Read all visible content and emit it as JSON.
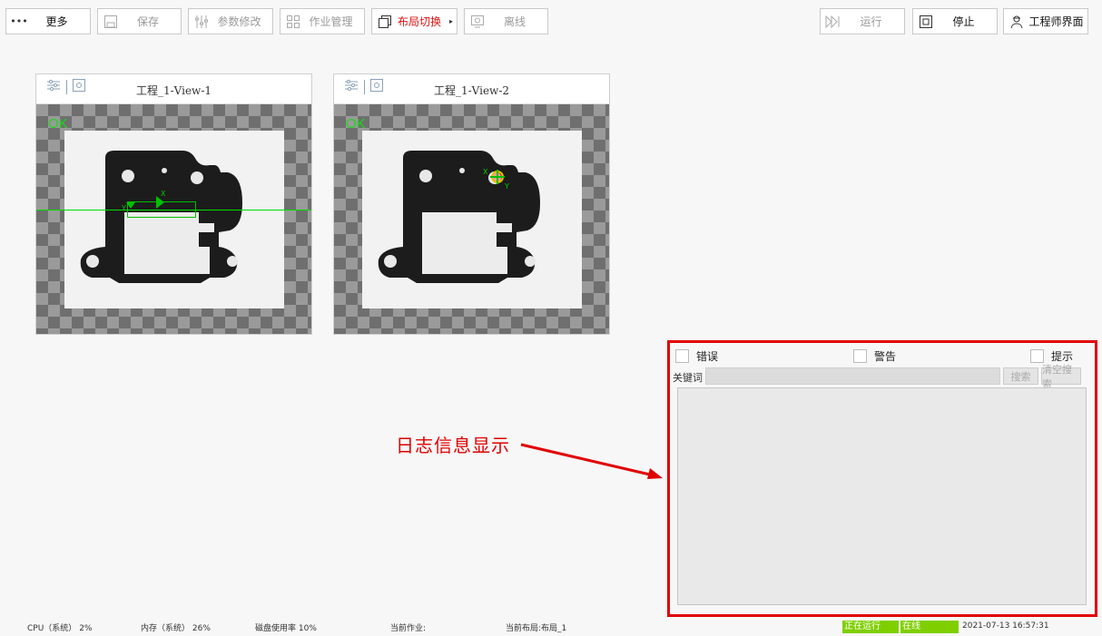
{
  "toolbar": {
    "more": "更多",
    "save": "保存",
    "params": "参数修改",
    "jobs": "作业管理",
    "layout": "布局切换",
    "offline": "离线",
    "run": "运行",
    "stop": "停止",
    "engineer": "工程师界面"
  },
  "views": [
    {
      "title": "工程_1-View-1",
      "result": "OK",
      "marker_x": "X",
      "marker_y": "Y"
    },
    {
      "title": "工程_1-View-2",
      "result": "OK",
      "marker_x": "X",
      "marker_y": "Y"
    }
  ],
  "log": {
    "error": "错误",
    "warning": "警告",
    "hint": "提示",
    "keyword_label": "关键词",
    "keyword_value": "",
    "search": "搜索",
    "clear_search": "清空搜索"
  },
  "annotation": "日志信息显示",
  "status": {
    "cpu": "CPU（系统）",
    "cpu_val": "2%",
    "mem": "内存（系统）",
    "mem_val": "26%",
    "disk": "磁盘使用率",
    "disk_val": "10%",
    "current_job": "当前作业:",
    "current_layout": "当前布局:",
    "layout_val": "布局_1",
    "running": "正在运行",
    "online": "在线",
    "datetime": "2021-07-13 16:57:31"
  },
  "colors": {
    "annotation_red": "#e00000",
    "ok_green": "#1ed61e",
    "status_green": "#7fcf00"
  }
}
